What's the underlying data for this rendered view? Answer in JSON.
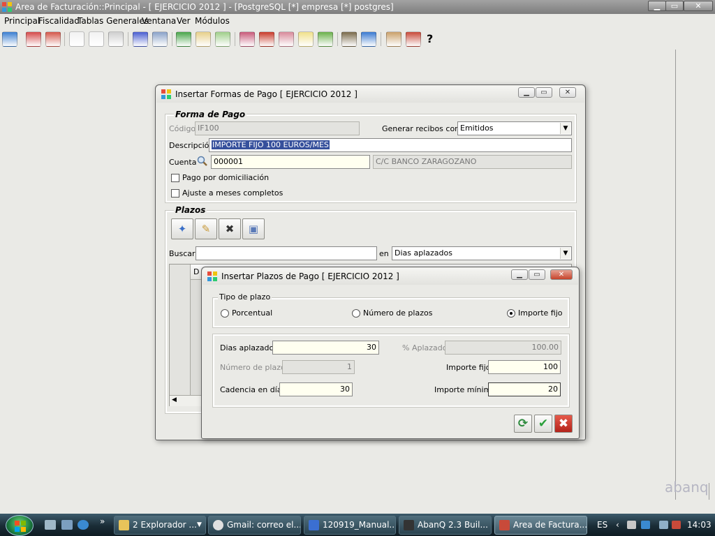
{
  "main_window": {
    "title": "Area de Facturación::Principal  - [ EJERCICIO 2012 ] - [PostgreSQL [*] empresa [*] postgres]",
    "controls": {
      "minimize": "▁",
      "maximize": "▭",
      "close": "✕"
    }
  },
  "menu": [
    "Principal",
    "Fiscalidad",
    "Tablas Generales",
    "Ventana",
    "Ver",
    "Módulos"
  ],
  "toolbar": {
    "icons": [
      {
        "name": "home-icon",
        "color": "#3b7fd1"
      },
      {
        "name": "users-icon",
        "color": "#d44a4a"
      },
      {
        "name": "users-group-icon",
        "color": "#d4574a"
      },
      {
        "name": "calendar-icon",
        "color": "#f2f2f2"
      },
      {
        "name": "document-abc-icon",
        "color": "#f2f2f2"
      },
      {
        "name": "print-icon",
        "color": "#cfcfcf"
      },
      {
        "name": "edit-icon",
        "color": "#4a5fd1"
      },
      {
        "name": "lock-icon",
        "color": "#8aa2c8"
      },
      {
        "name": "download-icon",
        "color": "#49a54a"
      },
      {
        "name": "document-icon",
        "color": "#e7d08a"
      },
      {
        "name": "document-export-icon",
        "color": "#9fcf8a"
      },
      {
        "name": "people-icon",
        "color": "#c85a7a"
      },
      {
        "name": "calculator-icon",
        "color": "#c83a2a"
      },
      {
        "name": "people-list-icon",
        "color": "#d88a9a"
      },
      {
        "name": "notes-icon",
        "color": "#f0e08a"
      },
      {
        "name": "spreadsheet-icon",
        "color": "#6ab04a"
      },
      {
        "name": "box-icon",
        "color": "#7a6a4a"
      },
      {
        "name": "globe-icon",
        "color": "#3a7ad1"
      },
      {
        "name": "user-icon",
        "color": "#caa06a"
      },
      {
        "name": "tools-icon",
        "color": "#c84a3a"
      },
      {
        "name": "help-pointer-icon",
        "color": "#333333"
      }
    ]
  },
  "watermark": "abanq",
  "dialog_forma": {
    "title": "Insertar Formas de Pago [ EJERCICIO 2012 ]",
    "group_title": "Forma de Pago",
    "codigo_label": "Código",
    "codigo_value": "IF100",
    "generar_label": "Generar recibos como",
    "generar_value": "Emitidos",
    "descripcion_label": "Descripción",
    "descripcion_value": "IMPORTE FIJO 100 EUROS/MES",
    "cuenta_label": "Cuenta",
    "cuenta_value": "000001",
    "cuenta_desc": "C/C BANCO ZARAGOZANO",
    "domiciliacion_label": "Pago por domiciliación",
    "ajuste_label": "Ajuste a meses completos",
    "plazos_title": "Plazos",
    "buscar_label": "Buscar",
    "en_label": "en",
    "en_value": "Dias aplazados",
    "grid_header_first": "D"
  },
  "dialog_plazos": {
    "title": "Insertar Plazos de Pago [ EJERCICIO 2012 ]",
    "tipo_title": "Tipo de plazo",
    "radio_porcentual": "Porcentual",
    "radio_numero": "Número de plazos",
    "radio_importe": "Importe fijo",
    "dias_label": "Dias aplazados",
    "dias_value": "30",
    "aplazado_label": "% Aplazado",
    "aplazado_value": "100.00",
    "numero_label": "Número de plazos",
    "numero_value": "1",
    "importe_fijo_label": "Importe fijo",
    "importe_fijo_value": "100",
    "cadencia_label": "Cadencia en días",
    "cadencia_value": "30",
    "importe_min_label": "Importe mínimo",
    "importe_min_value": "20"
  },
  "taskbar": {
    "items": [
      {
        "label": "2 Explorador ...",
        "color": "#e8c45a"
      },
      {
        "label": "Gmail: correo el...",
        "color": "#e0e0e0"
      },
      {
        "label": "120919_Manual...",
        "color": "#3b6fd1"
      },
      {
        "label": "AbanQ 2.3 Buil...",
        "color": "#333333"
      },
      {
        "label": "Area de Factura...",
        "color": "#c84a3a"
      }
    ],
    "language": "ES",
    "clock": "14:03"
  }
}
